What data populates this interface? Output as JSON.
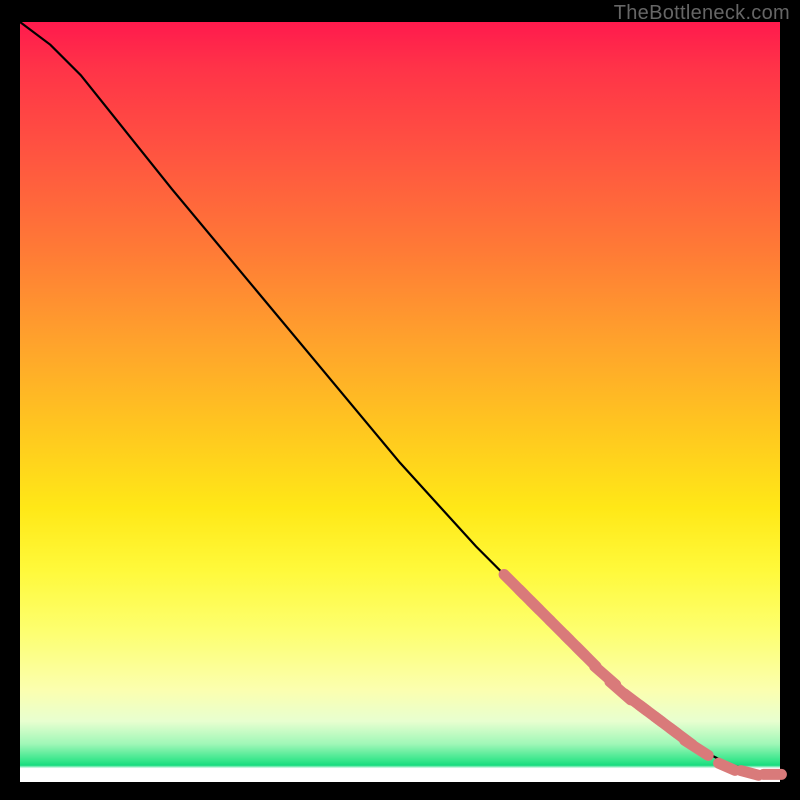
{
  "watermark": "TheBottleneck.com",
  "chart_data": {
    "type": "line",
    "title": "",
    "xlabel": "",
    "ylabel": "",
    "xlim": [
      0,
      100
    ],
    "ylim": [
      0,
      100
    ],
    "grid": false,
    "background_gradient": {
      "top": "#ff1a4d",
      "mid_upper": "#ff9a2a",
      "mid": "#ffe817",
      "lower": "#fbffb0",
      "near_bottom": "#35e68a",
      "bottom": "#ffffff"
    },
    "series": [
      {
        "name": "bottleneck-curve",
        "color": "#000000",
        "x": [
          0,
          4,
          8,
          12,
          20,
          30,
          40,
          50,
          60,
          66,
          70,
          74,
          78,
          82,
          86,
          90,
          93,
          95,
          97,
          98,
          99,
          100
        ],
        "y": [
          100,
          97,
          93,
          88,
          78,
          66,
          54,
          42,
          31,
          25,
          21,
          17,
          13,
          10,
          7,
          4,
          2.5,
          1.8,
          1.2,
          1.0,
          1.0,
          1.0
        ]
      }
    ],
    "markers": {
      "name": "highlighted-segments",
      "color": "#d97a7a",
      "shape": "rounded-capsule",
      "points_x": [
        65,
        67,
        68.5,
        71,
        73,
        74.5,
        77,
        79,
        81,
        83,
        85,
        87,
        89,
        93,
        96,
        99
      ],
      "points_y": [
        26,
        24,
        22.5,
        20,
        18,
        16.5,
        14,
        12,
        10.5,
        9,
        7.5,
        6,
        4.5,
        2,
        1.2,
        1.0
      ]
    }
  }
}
